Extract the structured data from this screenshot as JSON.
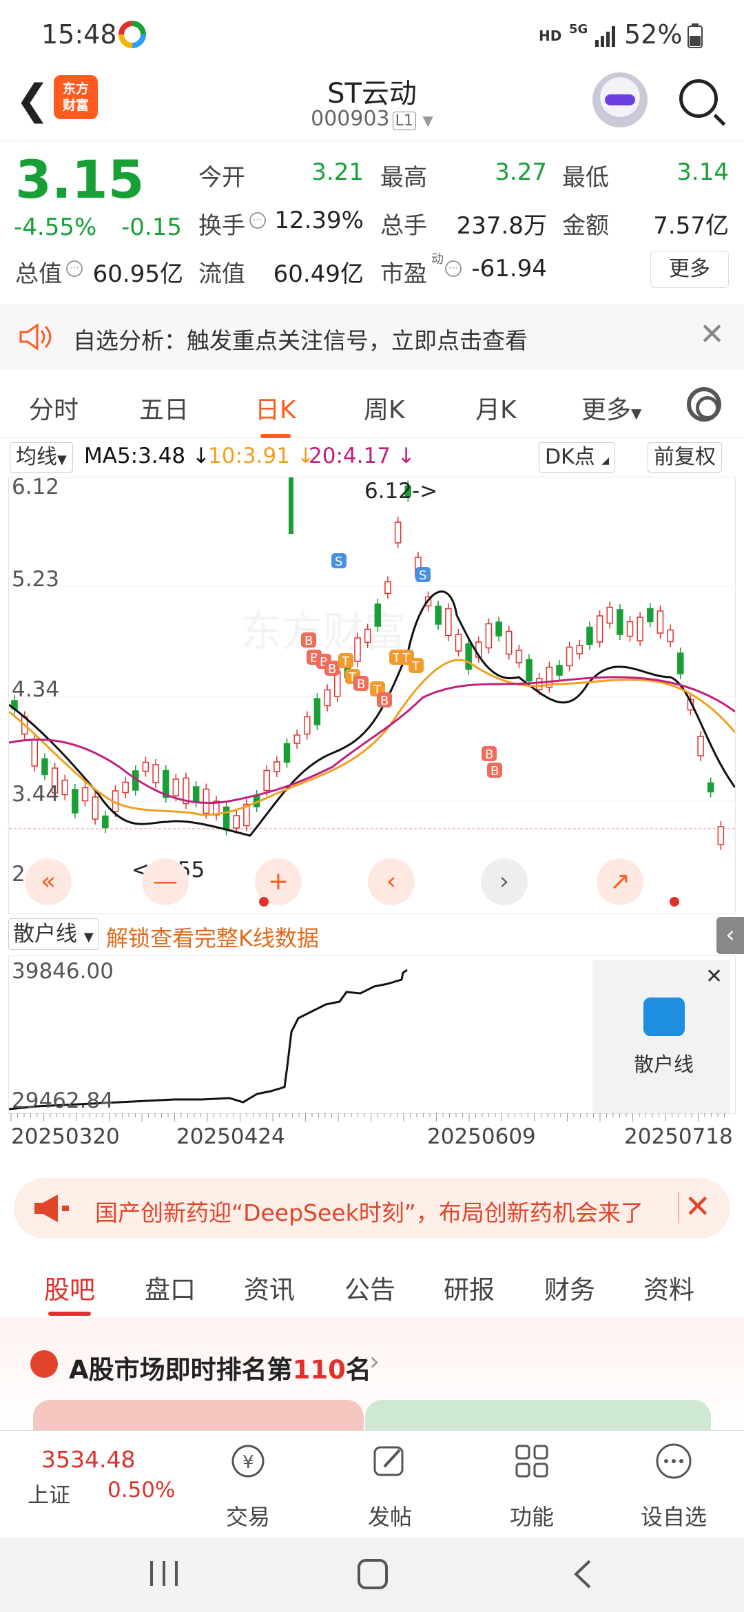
{
  "status": {
    "time": "15:48",
    "net": "HD",
    "sig": "5G",
    "battery": "52%"
  },
  "header": {
    "title": "ST云动",
    "code": "000903",
    "level": "L1",
    "logo_line1": "东方",
    "logo_line2": "财富"
  },
  "quote": {
    "price": "3.15",
    "change_pct": "-4.55%",
    "change": "-0.15",
    "open_label": "今开",
    "open": "3.21",
    "high_label": "最高",
    "high": "3.27",
    "low_label": "最低",
    "low": "3.14",
    "turnover_label": "换手",
    "turnover": "12.39%",
    "volume_label": "总手",
    "volume": "237.8万",
    "amount_label": "金额",
    "amount": "7.57亿",
    "mcap_label": "总值",
    "mcap": "60.95亿",
    "float_label": "流值",
    "float": "60.49亿",
    "pe_label": "市盈",
    "pe_sup": "动",
    "pe": "-61.94",
    "more": "更多"
  },
  "notice": {
    "text": "自选分析：触发重点关注信号，立即点击查看"
  },
  "tabs": [
    "分时",
    "五日",
    "日K",
    "周K",
    "月K",
    "更多"
  ],
  "indicators": {
    "ma_select": "均线",
    "ma5": "MA5:3.48 ↓",
    "ma10": "10:3.91 ↓",
    "ma20": "20:4.17 ↓",
    "dk": "DK点",
    "fq": "前复权"
  },
  "chart": {
    "y_labels": [
      "6.12",
      "5.23",
      "4.34",
      "3.44",
      "2.55"
    ],
    "max_note": "6.12->",
    "min_note": "<-2.55"
  },
  "sanhu": {
    "select": "散户线",
    "unlock": "解锁查看完整K线数据",
    "y_top": "39846.00",
    "y_bottom": "29462.84",
    "panel_label": "散户线"
  },
  "x_labels": [
    "20250320",
    "20250424",
    "20250609",
    "20250718"
  ],
  "banner": {
    "text": "国产创新药迎“DeepSeek时刻”，布局创新药机会来了"
  },
  "section_tabs": [
    "股吧",
    "盘口",
    "资讯",
    "公告",
    "研报",
    "财务",
    "资料"
  ],
  "rank": {
    "prefix": "A股市场即时排名第",
    "num": "110",
    "suffix": "名"
  },
  "bottom": {
    "index_value": "3534.48",
    "index_name": "上证",
    "index_pct": "0.50%",
    "items": [
      "交易",
      "发帖",
      "功能",
      "设自选"
    ]
  },
  "colors": {
    "up": "#e0302b",
    "down": "#18a037",
    "accent": "#ff5a1f",
    "ma5": "#111111",
    "ma10": "#f0a020",
    "ma20": "#c0207a"
  }
}
